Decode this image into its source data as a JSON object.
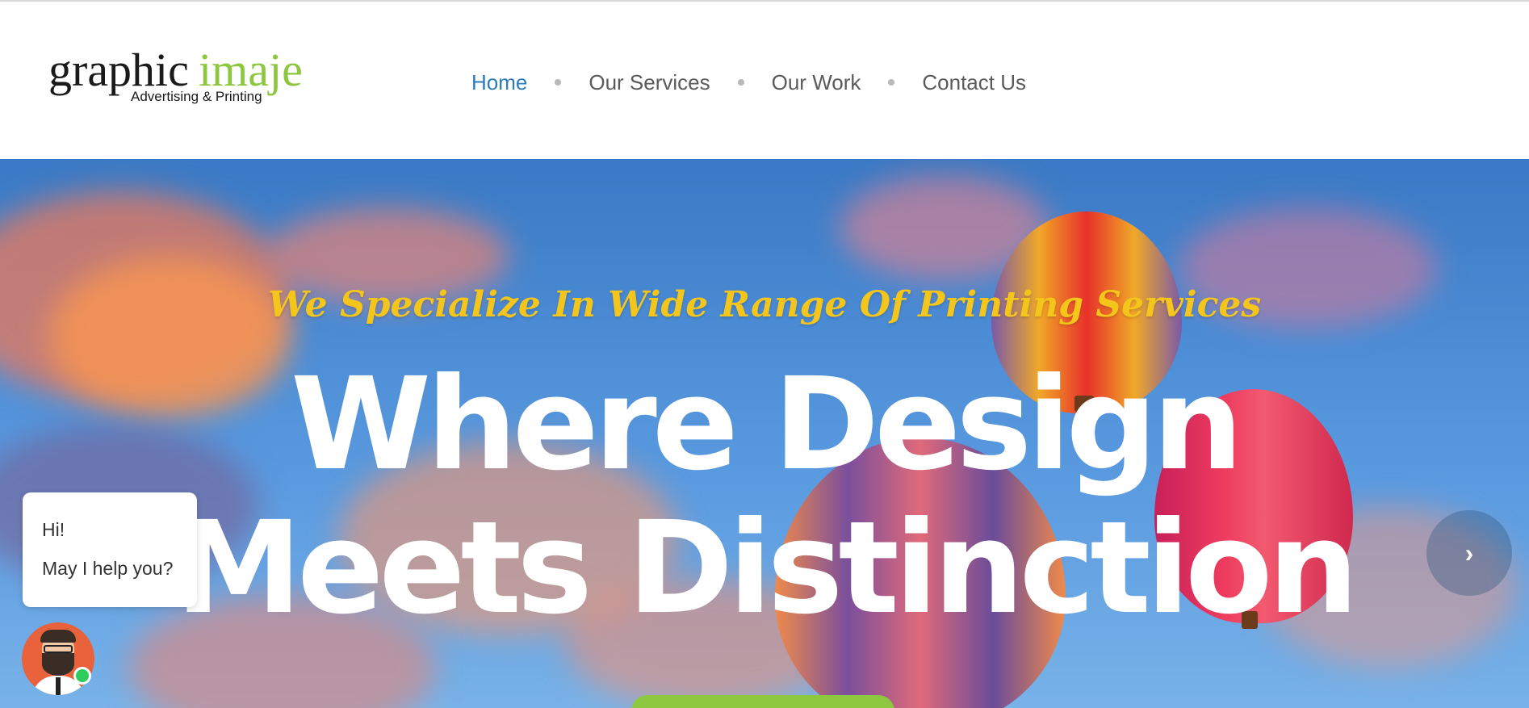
{
  "logo": {
    "brand_part1": "graphic",
    "brand_part2": "imaje",
    "tagline": "Advertising & Printing"
  },
  "nav": {
    "items": [
      {
        "label": "Home",
        "active": true
      },
      {
        "label": "Our Services",
        "active": false
      },
      {
        "label": "Our Work",
        "active": false
      },
      {
        "label": "Contact Us",
        "active": false
      }
    ]
  },
  "hero": {
    "subtitle": "We Specialize In Wide Range Of Printing Services",
    "title_line1": "Where Design",
    "title_line2": "Meets Distinction",
    "next_icon": "chevron-right-icon"
  },
  "chat": {
    "line1": "Hi!",
    "line2": "May I help you?",
    "avatar_icon": "support-agent-avatar",
    "status": "online"
  },
  "colors": {
    "nav_active": "#2b7bbd",
    "nav_inactive": "#5a5a5a",
    "brand_green": "#8dc63f",
    "subtitle_yellow": "#f4c61c",
    "online_green": "#2ecc5b"
  }
}
